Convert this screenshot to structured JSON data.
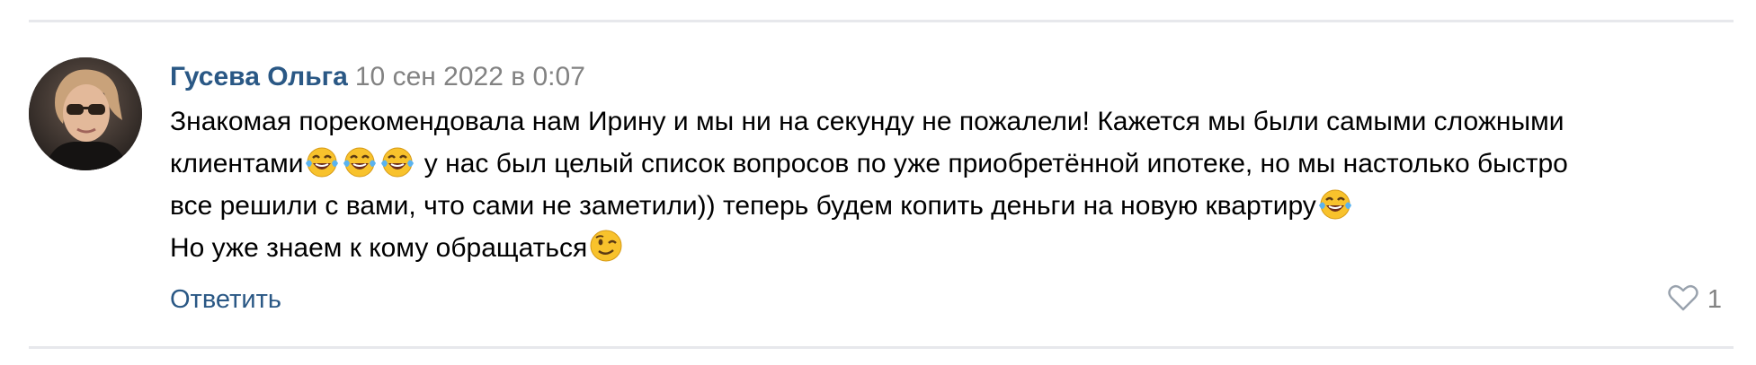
{
  "comment": {
    "author": "Гусева Ольга",
    "date": "10 сен 2022 в 0:07",
    "lines": {
      "l1": "Знакомая порекомендовала нам Ирину и мы ни на секунду не пожалели! Кажется мы были самыми сложными",
      "l2_start": "клиентами",
      "l2_rest": " у нас был целый список вопросов по уже приобретённой ипотеке, но мы настолько быстро",
      "l3": "все решили с вами, что сами не заметили)) теперь будем копить деньги на новую квартиру",
      "l4": "Но уже знаем к кому обращаться"
    },
    "emojis": [
      "face-with-tears-of-joy",
      "face-with-tears-of-joy",
      "face-with-tears-of-joy",
      "face-with-tears-of-joy",
      "winking-face"
    ],
    "reply_label": "Ответить",
    "like_count": "1",
    "like_icon": "heart-outline-icon"
  },
  "colors": {
    "link": "#2a5885",
    "muted": "#828282",
    "divider": "#e7e8ec",
    "emoji_face": "#f8c22c",
    "emoji_tears": "#5ab3f0"
  }
}
